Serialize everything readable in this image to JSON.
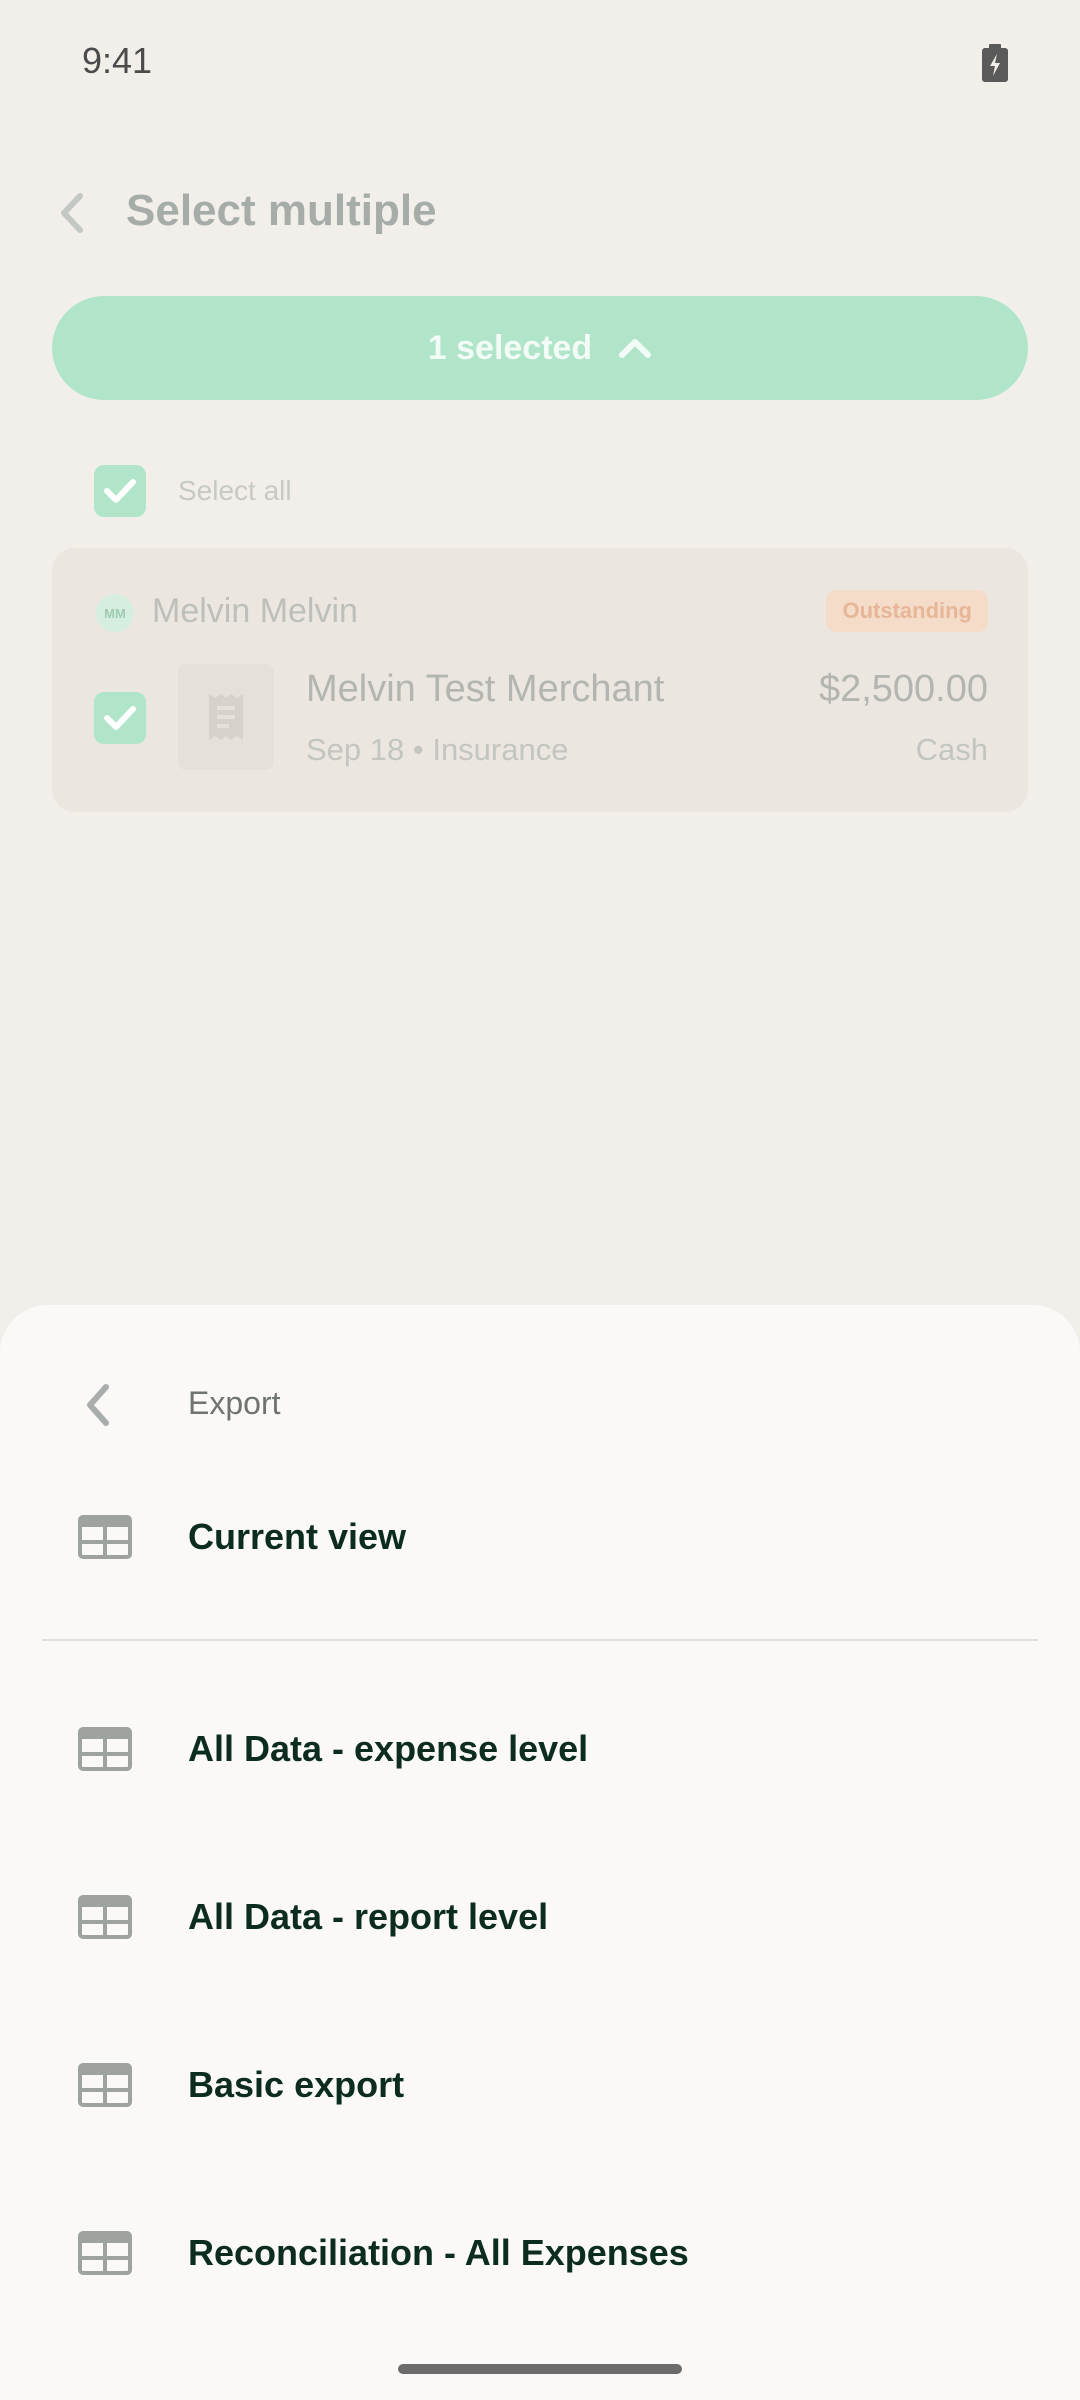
{
  "status_bar": {
    "time": "9:41"
  },
  "header": {
    "title": "Select multiple"
  },
  "selection": {
    "label": "1 selected",
    "select_all_label": "Select all"
  },
  "expense": {
    "avatar_initials": "MM",
    "owner": "Melvin Melvin",
    "status": "Outstanding",
    "merchant": "Melvin Test Merchant",
    "meta": "Sep 18 • Insurance",
    "amount": "$2,500.00",
    "payment_type": "Cash"
  },
  "export_sheet": {
    "title": "Export",
    "items": [
      {
        "label": "Current view",
        "icon": "table-icon"
      },
      {
        "label": "All Data - expense level",
        "icon": "table-icon"
      },
      {
        "label": "All Data - report level",
        "icon": "table-icon"
      },
      {
        "label": "Basic export",
        "icon": "table-icon"
      },
      {
        "label": "Reconciliation - All Expenses",
        "icon": "table-icon"
      }
    ]
  },
  "colors": {
    "accent": "#b0e5c9",
    "sheet_background": "#faf9f7",
    "text_dark": "#0b2c1f",
    "badge_background": "#f5dcc9"
  }
}
